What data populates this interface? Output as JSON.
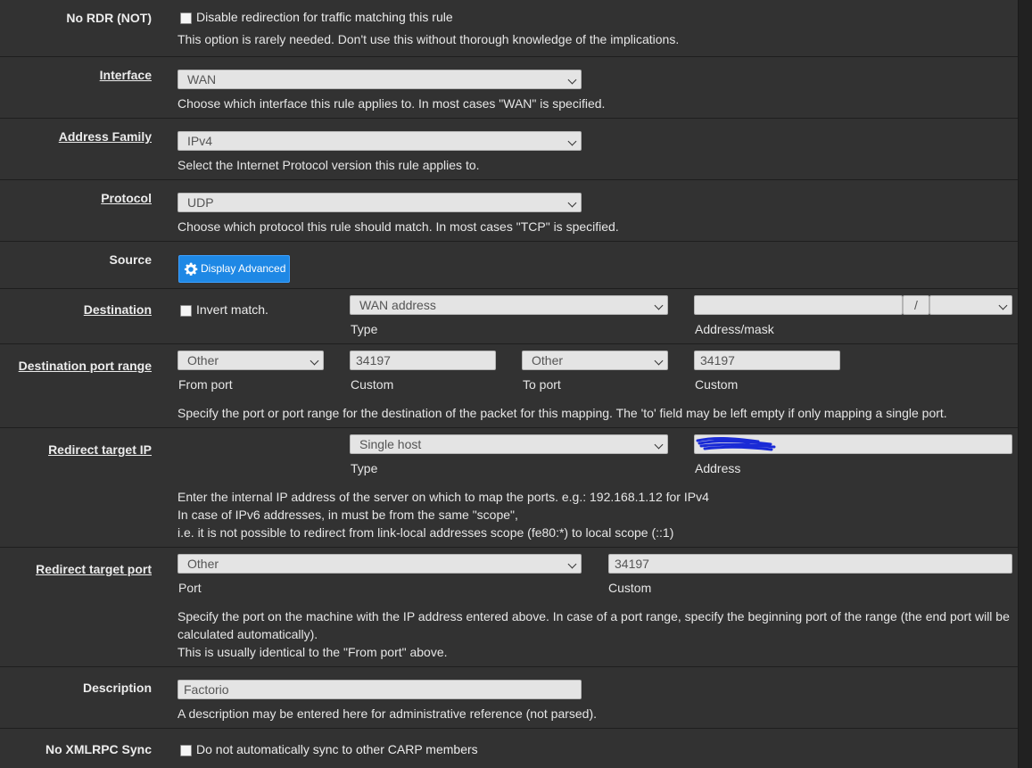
{
  "rows": {
    "nordr": {
      "label": "No RDR (NOT)",
      "checkbox_label": "Disable redirection for traffic matching this rule",
      "help": "This option is rarely needed. Don't use this without thorough knowledge of the implications."
    },
    "interface": {
      "label": "Interface",
      "value": "WAN",
      "help": "Choose which interface this rule applies to. In most cases \"WAN\" is specified."
    },
    "family": {
      "label": "Address Family",
      "value": "IPv4",
      "help": "Select the Internet Protocol version this rule applies to."
    },
    "protocol": {
      "label": "Protocol",
      "value": "UDP",
      "help": "Choose which protocol this rule should match. In most cases \"TCP\" is specified."
    },
    "source": {
      "label": "Source",
      "button": "Display Advanced"
    },
    "destination": {
      "label": "Destination",
      "invert_label": "Invert match.",
      "type_value": "WAN address",
      "type_caption": "Type",
      "mask_sep": "/",
      "addr_caption": "Address/mask"
    },
    "dport": {
      "label": "Destination port range",
      "from_value": "Other",
      "from_caption": "From port",
      "from_custom": "34197",
      "from_custom_caption": "Custom",
      "to_value": "Other",
      "to_caption": "To port",
      "to_custom": "34197",
      "to_custom_caption": "Custom",
      "help": "Specify the port or port range for the destination of the packet for this mapping. The 'to' field may be left empty if only mapping a single port."
    },
    "rtip": {
      "label": "Redirect target IP",
      "type_value": "Single host",
      "type_caption": "Type",
      "addr_caption": "Address",
      "help1": "Enter the internal IP address of the server on which to map the ports. e.g.: 192.168.1.12 for IPv4",
      "help2": "In case of IPv6 addresses, in must be from the same \"scope\",",
      "help3": "i.e. it is not possible to redirect from link-local addresses scope (fe80:*) to local scope (::1)"
    },
    "rtport": {
      "label": "Redirect target port",
      "port_value": "Other",
      "port_caption": "Port",
      "custom_value": "34197",
      "custom_caption": "Custom",
      "help1": "Specify the port on the machine with the IP address entered above. In case of a port range, specify the beginning port of the range (the end port will be",
      "help2": "calculated automatically).",
      "help3": "This is usually identical to the \"From port\" above."
    },
    "description": {
      "label": "Description",
      "value": "Factorio",
      "help": "A description may be entered here for administrative reference (not parsed)."
    },
    "xmlrpc": {
      "label": "No XMLRPC Sync",
      "checkbox_label": "Do not automatically sync to other CARP members"
    }
  },
  "colors": {
    "panel_bg": "#323232",
    "page_bg": "#212121",
    "button_bg": "#1e88e5",
    "redaction": "#1a2bd6"
  },
  "icons": [
    "gear-icon",
    "chevron-down-icon"
  ]
}
